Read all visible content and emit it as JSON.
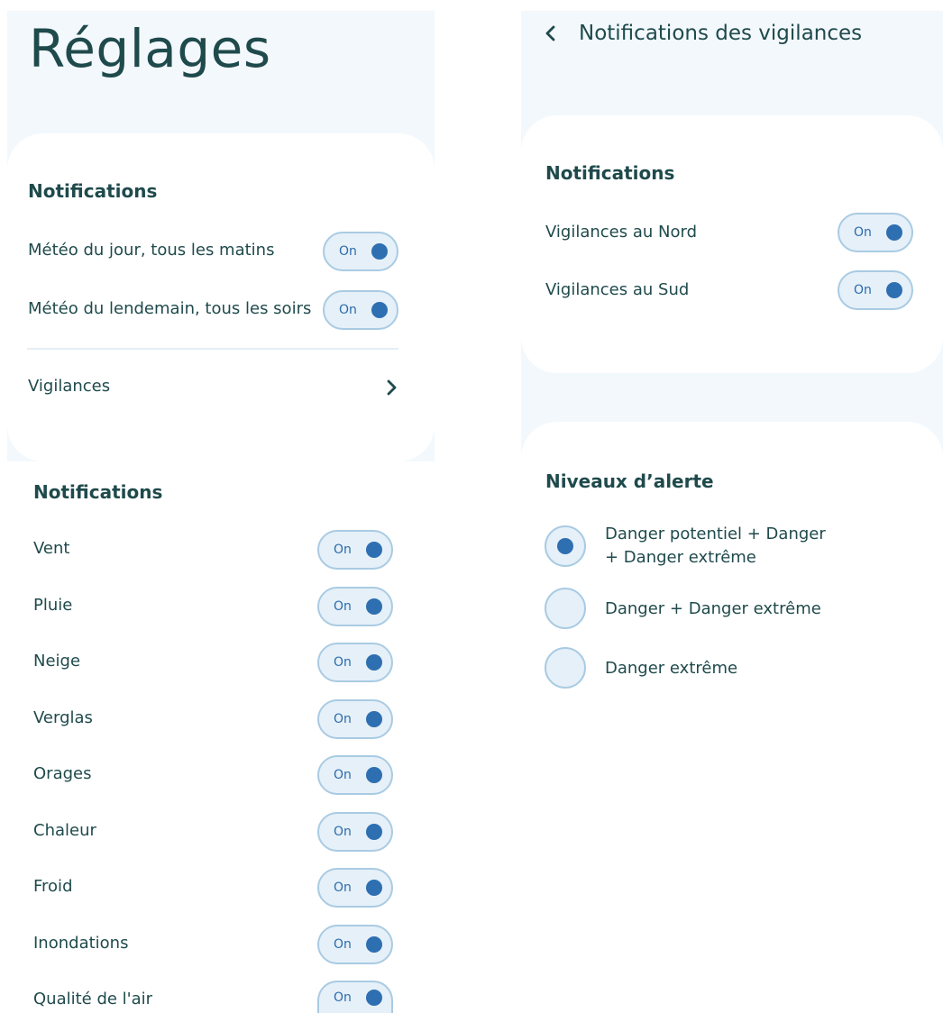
{
  "left_panel": {
    "title": "Réglages",
    "section_title": "Notifications",
    "items": [
      {
        "label": "Météo du jour, tous les matins",
        "toggle": "On"
      },
      {
        "label": "Météo du lendemain, tous les soirs",
        "toggle": "On"
      }
    ],
    "vigilances_link": "Vigilances"
  },
  "bottom_left": {
    "section_title": "Notifications",
    "items": [
      {
        "label": "Vent",
        "toggle": "On"
      },
      {
        "label": "Pluie",
        "toggle": "On"
      },
      {
        "label": "Neige",
        "toggle": "On"
      },
      {
        "label": "Verglas",
        "toggle": "On"
      },
      {
        "label": "Orages",
        "toggle": "On"
      },
      {
        "label": "Chaleur",
        "toggle": "On"
      },
      {
        "label": "Froid",
        "toggle": "On"
      },
      {
        "label": "Inondations",
        "toggle": "On"
      },
      {
        "label": "Qualité de l'air",
        "toggle": "On"
      }
    ]
  },
  "right_panel": {
    "header_title": "Notifications des vigilances",
    "section_title": "Notifications",
    "items": [
      {
        "label": "Vigilances au Nord",
        "toggle": "On"
      },
      {
        "label": "Vigilances au Sud",
        "toggle": "On"
      }
    ]
  },
  "alert_levels": {
    "section_title": "Niveaux d’alerte",
    "options": [
      {
        "line1": "Danger potentiel + Danger",
        "line2": "+ Danger extrême",
        "selected": true
      },
      {
        "line1": "Danger + Danger extrême",
        "line2": "",
        "selected": false
      },
      {
        "line1": "Danger extrême",
        "line2": "",
        "selected": false
      }
    ]
  },
  "colors": {
    "text": "#1f4a4c",
    "panel_background": "#f3f8fc",
    "toggle_fill": "#e6f0f8",
    "toggle_border": "#a9cbe3",
    "accent": "#2e6fb1"
  }
}
